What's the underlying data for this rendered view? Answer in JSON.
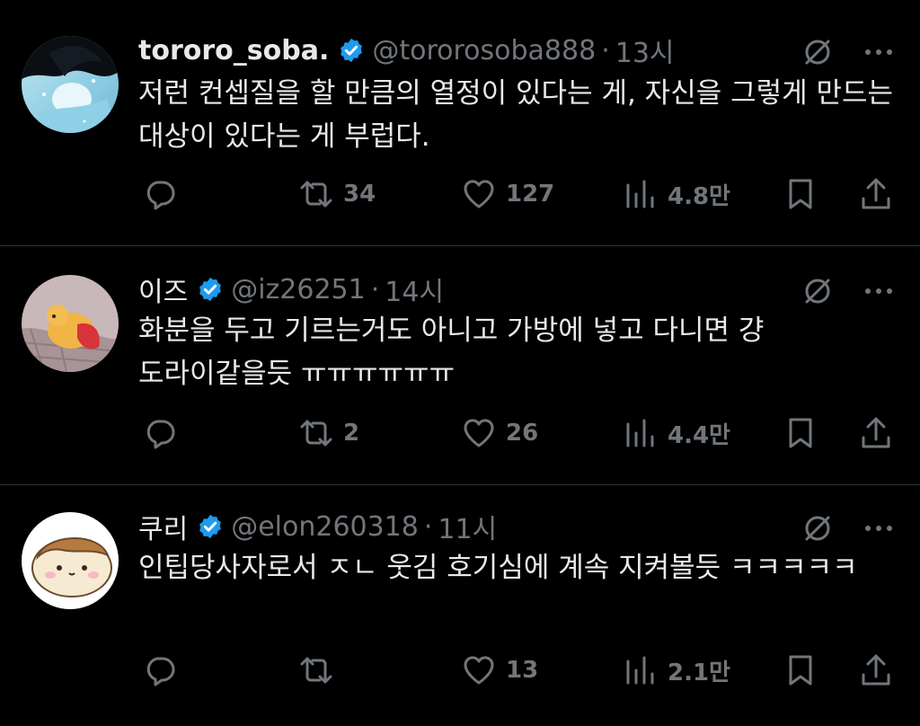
{
  "colors": {
    "background": "#000000",
    "primary_text": "#e7e9ea",
    "secondary_text": "#71767b",
    "verified": "#1d9bf0",
    "divider": "#2f3336"
  },
  "tweets": [
    {
      "name": "tororo_soba.",
      "handle": "@tororosoba888",
      "dot": "·",
      "time": "13시",
      "text": "저런 컨셉질을 할 만큼의 열정이 있다는 게, 자신을 그렇게 만드는 대상이 있다는 게 부럽다.",
      "retweets": "34",
      "likes": "127",
      "views": "4.8만",
      "avatar_icon": "anime-girl-water-avatar"
    },
    {
      "name": "이즈",
      "handle": "@iz26251",
      "dot": "·",
      "time": "14시",
      "text": "화분을 두고 기르는거도 아니고 가방에 넣고 다니면 걍 도라이같을듯 ㅠㅠㅠㅠㅠㅠ",
      "retweets": "2",
      "likes": "26",
      "views": "4.4만",
      "avatar_icon": "pooh-plush-avatar"
    },
    {
      "name": "쿠리",
      "handle": "@elon260318",
      "dot": "·",
      "time": "11시",
      "text": "인팁당사자로서 ㅈㄴ 웃김 호기심에 계속 지켜볼듯 ㅋㅋㅋㅋㅋ",
      "retweets": "",
      "likes": "13",
      "views": "2.1만",
      "avatar_icon": "bread-character-avatar"
    }
  ],
  "icons": {
    "reply": "reply-icon",
    "retweet": "retweet-icon",
    "like": "heart-icon",
    "views": "views-chart-icon",
    "bookmark": "bookmark-icon",
    "share": "share-icon",
    "grok": "grok-icon",
    "more": "more-icon",
    "verified": "verified-badge-icon"
  }
}
